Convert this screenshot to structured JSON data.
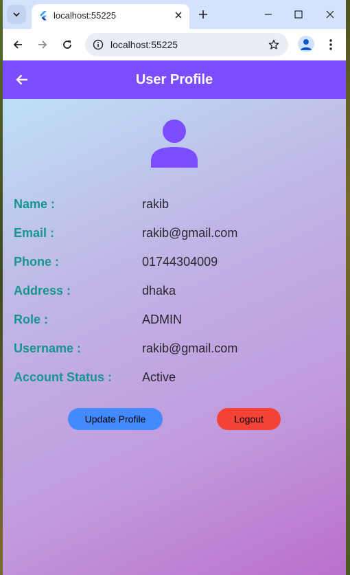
{
  "browser": {
    "tab_title": "localhost:55225",
    "url": "localhost:55225"
  },
  "appbar": {
    "title": "User Profile",
    "color": "#7c4dff"
  },
  "profile": {
    "fields": [
      {
        "label": "Name :",
        "value": "rakib"
      },
      {
        "label": "Email :",
        "value": "rakib@gmail.com"
      },
      {
        "label": "Phone :",
        "value": "01744304009"
      },
      {
        "label": "Address :",
        "value": "dhaka"
      },
      {
        "label": "Role :",
        "value": "ADMIN"
      },
      {
        "label": "Username :",
        "value": "rakib@gmail.com"
      },
      {
        "label": "Account Status :",
        "value": "Active"
      }
    ],
    "avatar_icon": "person-icon"
  },
  "actions": {
    "update_label": "Update Profile",
    "logout_label": "Logout",
    "update_color": "#448aff",
    "logout_color": "#f44336"
  },
  "colors": {
    "label": "#16948f"
  }
}
